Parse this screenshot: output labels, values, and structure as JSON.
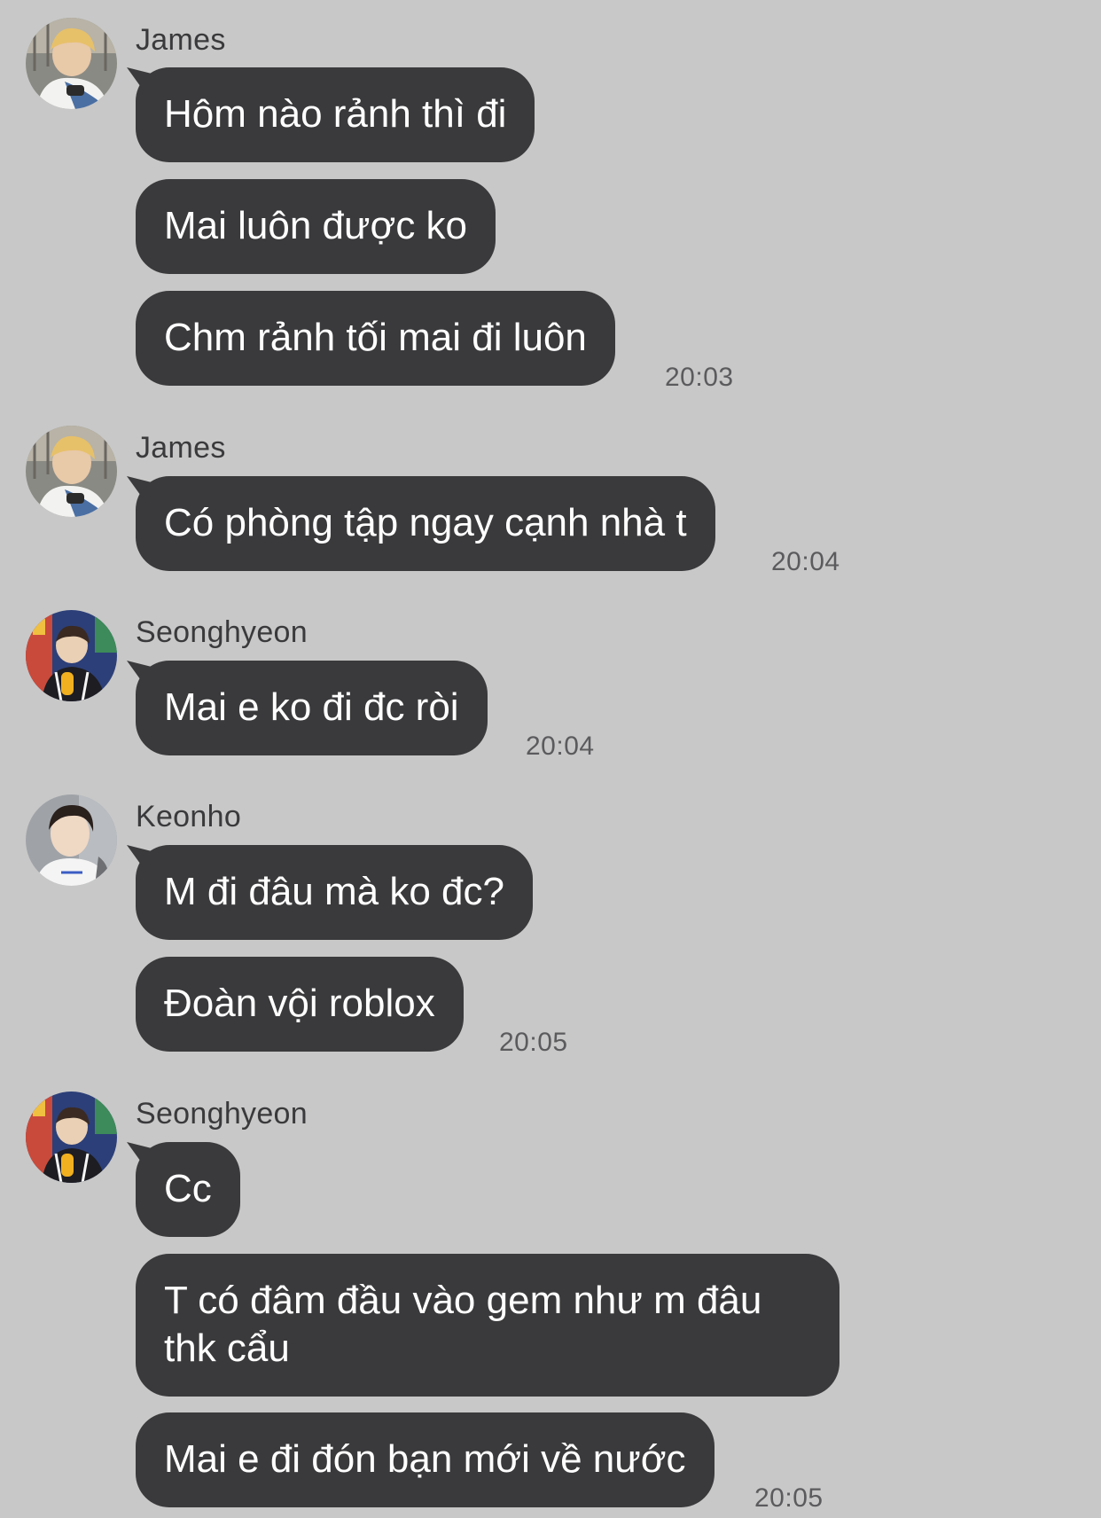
{
  "colors": {
    "background": "#c8c8c8",
    "bubble": "#3a3a3c",
    "bubble_text": "#ffffff",
    "sender_text": "#3a3a3c",
    "timestamp_text": "#5b5b5e"
  },
  "groups": [
    {
      "sender": "James",
      "avatar": "avatar-james",
      "messages": [
        "Hôm nào rảnh thì đi",
        "Mai luôn được ko",
        "Chm rảnh tối mai đi luôn"
      ],
      "time": "20:03"
    },
    {
      "sender": "James",
      "avatar": "avatar-james",
      "messages": [
        "Có phòng tập ngay cạnh nhà t"
      ],
      "time": "20:04"
    },
    {
      "sender": "Seonghyeon",
      "avatar": "avatar-seonghyeon",
      "messages": [
        "Mai e ko đi đc ròi"
      ],
      "time": "20:04"
    },
    {
      "sender": "Keonho",
      "avatar": "avatar-keonho",
      "messages": [
        "M đi đâu mà ko đc?",
        "Đoàn vội roblox"
      ],
      "time": "20:05"
    },
    {
      "sender": "Seonghyeon",
      "avatar": "avatar-seonghyeon",
      "messages": [
        "Cc",
        "T có đâm đầu vào gem như m đâu",
        "thk cẩu",
        "Mai e đi đón bạn mới về nước"
      ],
      "time": "20:05"
    }
  ]
}
